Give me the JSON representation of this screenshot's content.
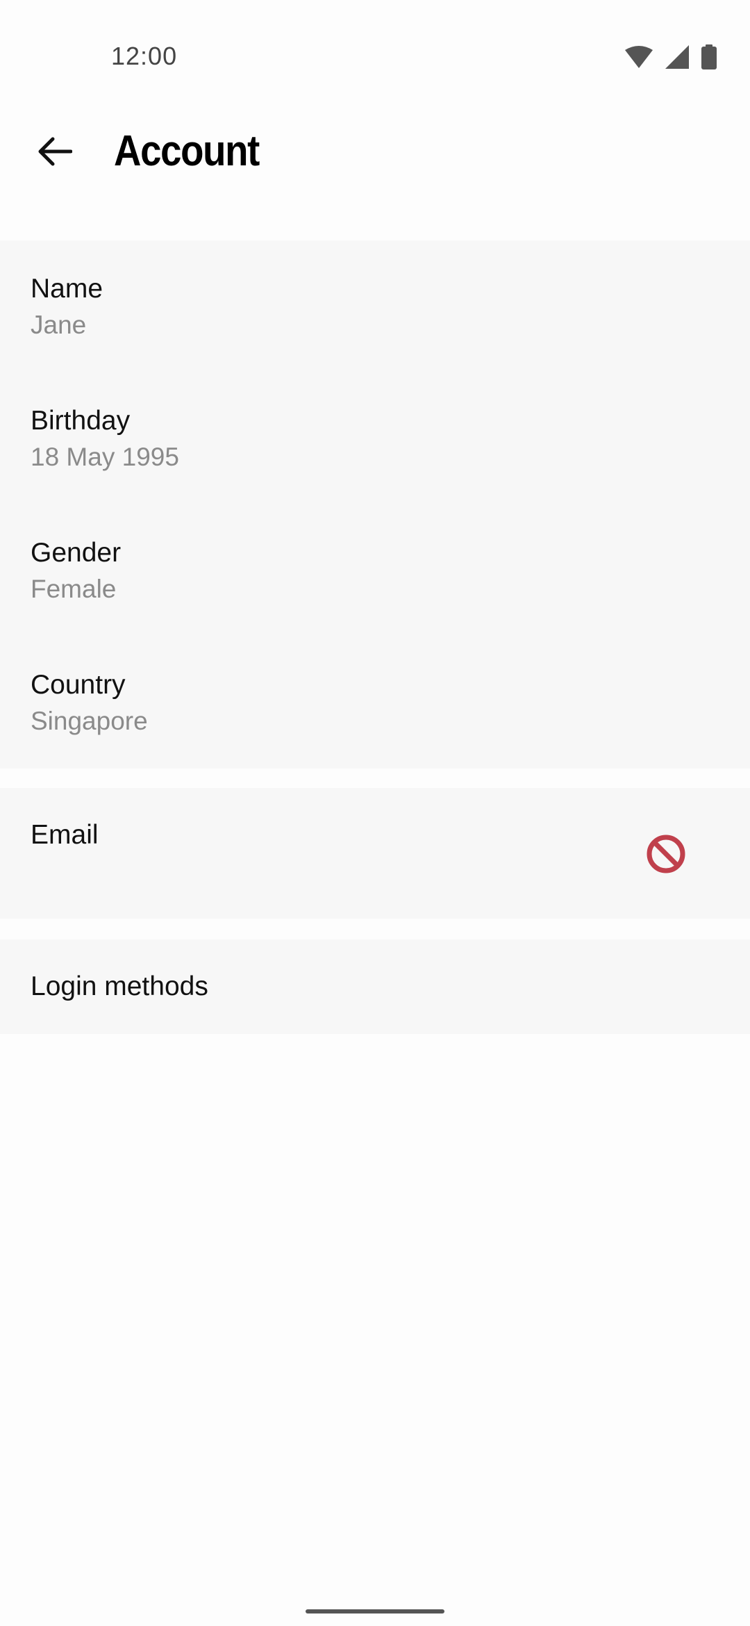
{
  "status_bar": {
    "time": "12:00",
    "icons": [
      "wifi-icon",
      "cellular-signal-icon",
      "battery-icon"
    ]
  },
  "app_bar": {
    "back_icon": "arrow-left-icon",
    "title": "Account"
  },
  "profile": {
    "items": [
      {
        "label": "Name",
        "value": "Jane"
      },
      {
        "label": "Birthday",
        "value": "18 May 1995"
      },
      {
        "label": "Gender",
        "value": "Female"
      },
      {
        "label": "Country",
        "value": "Singapore"
      }
    ]
  },
  "email": {
    "label": "Email",
    "status_icon": "blocked-icon",
    "status_color": "#c0404c"
  },
  "login": {
    "label": "Login methods"
  },
  "colors": {
    "background": "#fdfdfd",
    "card": "#f7f7f7",
    "secondary_text": "#8a8a8a"
  }
}
